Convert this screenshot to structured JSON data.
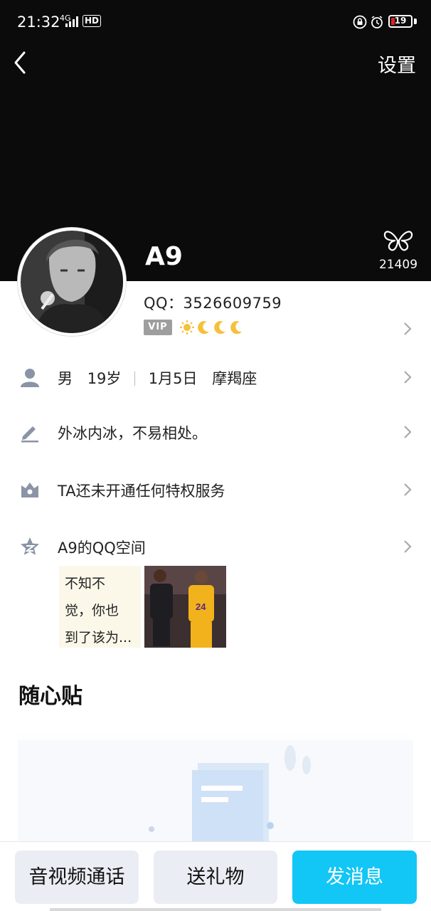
{
  "status_bar": {
    "time": "21:32",
    "network": "4G",
    "hd": "HD",
    "battery": "19",
    "battery_level": 0.19
  },
  "header": {
    "settings_label": "设置"
  },
  "profile": {
    "nickname": "A9",
    "qq_label": "QQ：3526609759",
    "vip_label": "VIP",
    "likes_count": "21409"
  },
  "rows": {
    "basic": {
      "gender": "男",
      "age": "19岁",
      "birthday": "1月5日",
      "zodiac": "摩羯座"
    },
    "signature": "外冰内冰，不易相处。",
    "privilege": "TA还未开通任何特权服务",
    "qzone": "A9的QQ空间"
  },
  "qzone_preview": {
    "text_lines": [
      "不知不",
      "觉，你也",
      "到了该为..."
    ]
  },
  "section": {
    "title": "随心贴"
  },
  "bottom_bar": {
    "call_label": "音视频通话",
    "gift_label": "送礼物",
    "message_label": "发消息"
  },
  "colors": {
    "accent": "#12c6f5",
    "battery_low": "#e02020",
    "vip_gray": "#9e9e9e"
  },
  "icons": [
    "back-arrow-icon",
    "butterfly-like-icon",
    "sun-level-icon",
    "moon-level-icon",
    "person-icon",
    "pencil-icon",
    "crown-icon",
    "qzone-star-icon",
    "chevron-right-icon"
  ]
}
